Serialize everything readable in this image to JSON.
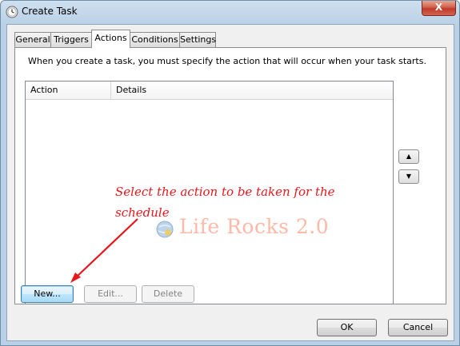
{
  "window": {
    "title": "Create Task",
    "close_symbol": "X"
  },
  "tabs": [
    {
      "label": "General"
    },
    {
      "label": "Triggers"
    },
    {
      "label": "Actions"
    },
    {
      "label": "Conditions"
    },
    {
      "label": "Settings"
    }
  ],
  "active_tab": "Actions",
  "actions_panel": {
    "description": "When you create a task, you must specify the action that will occur when your task starts.",
    "columns": [
      {
        "label": "Action"
      },
      {
        "label": "Details"
      }
    ],
    "rows": [],
    "move_up_symbol": "▲",
    "move_down_symbol": "▼",
    "new_label": "New...",
    "edit_label": "Edit...",
    "delete_label": "Delete"
  },
  "footer": {
    "ok_label": "OK",
    "cancel_label": "Cancel"
  },
  "annotation": {
    "line1": "Select the action to be taken for the",
    "line2": "schedule",
    "color": "#e8161b"
  },
  "watermark": {
    "text": "Life Rocks 2.0"
  }
}
